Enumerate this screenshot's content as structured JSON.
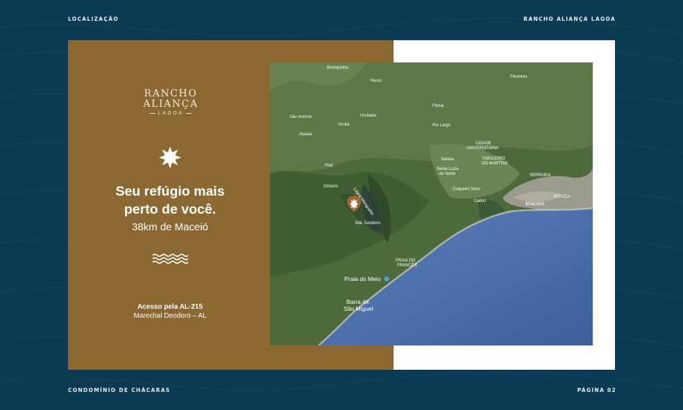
{
  "header": {
    "left": "LOCALIZAÇÃO",
    "right": "RANCHO ALIANÇA LAGOA"
  },
  "footer": {
    "left": "CONDOMÍNIO DE CHÁCARAS",
    "right": "PÁGINA 02"
  },
  "logo": {
    "line1": "RANCHO",
    "line2": "ALIANÇA",
    "line3": "LAGOA"
  },
  "headline": {
    "line1": "Seu refúgio mais",
    "line2": "perto de você."
  },
  "distance": "38km de Maceió",
  "access": {
    "road": "Acesso pela AL-215",
    "city": "Marechal Deodoro – AL"
  },
  "map_labels": {
    "branquinha": "Branquinha",
    "murici": "Murici",
    "flexeiras": "Flexeiras",
    "sao_antonio": "São Antônio",
    "flexal": "Flexal",
    "uruba": "Urubá",
    "uruba2": "Urubaba",
    "rio_largo": "Rio Largo",
    "atalaia": "Atalaia",
    "cidade_univ_1": "CIDADE",
    "cidade_univ_2": "UNIVERSITÁRIA",
    "tabuleiro_1": "TABULEIRO",
    "tabuleiro_2": "DO MARTINS",
    "satuba": "Satuba",
    "santa_luzia_1": "Santa Luzia",
    "santa_luzia_2": "do Norte",
    "pilar": "Pilar",
    "serraria": "SERRARIA",
    "coqueiro_seco": "Coqueiro Seco",
    "orizeiro": "Orizeiro",
    "lagoa_manguaba": "Lagoa Manguaba",
    "jatiuca": "JATIÚCA",
    "cadoz": "Cadoz",
    "maceio": "Maceió",
    "mal_deodoro": "Mal. Deodoro",
    "praia_frances_1": "PRAIA DO",
    "praia_frances_2": "FRANCÊS",
    "praia_do_meio": "Praia do Meio",
    "barra_1": "Barra de",
    "barra_2": "São Miguel"
  },
  "colors": {
    "background": "#0b3a55",
    "brand_brown": "#8b6732",
    "cream": "#f3ead9",
    "ocean": "#4a6fb0"
  }
}
